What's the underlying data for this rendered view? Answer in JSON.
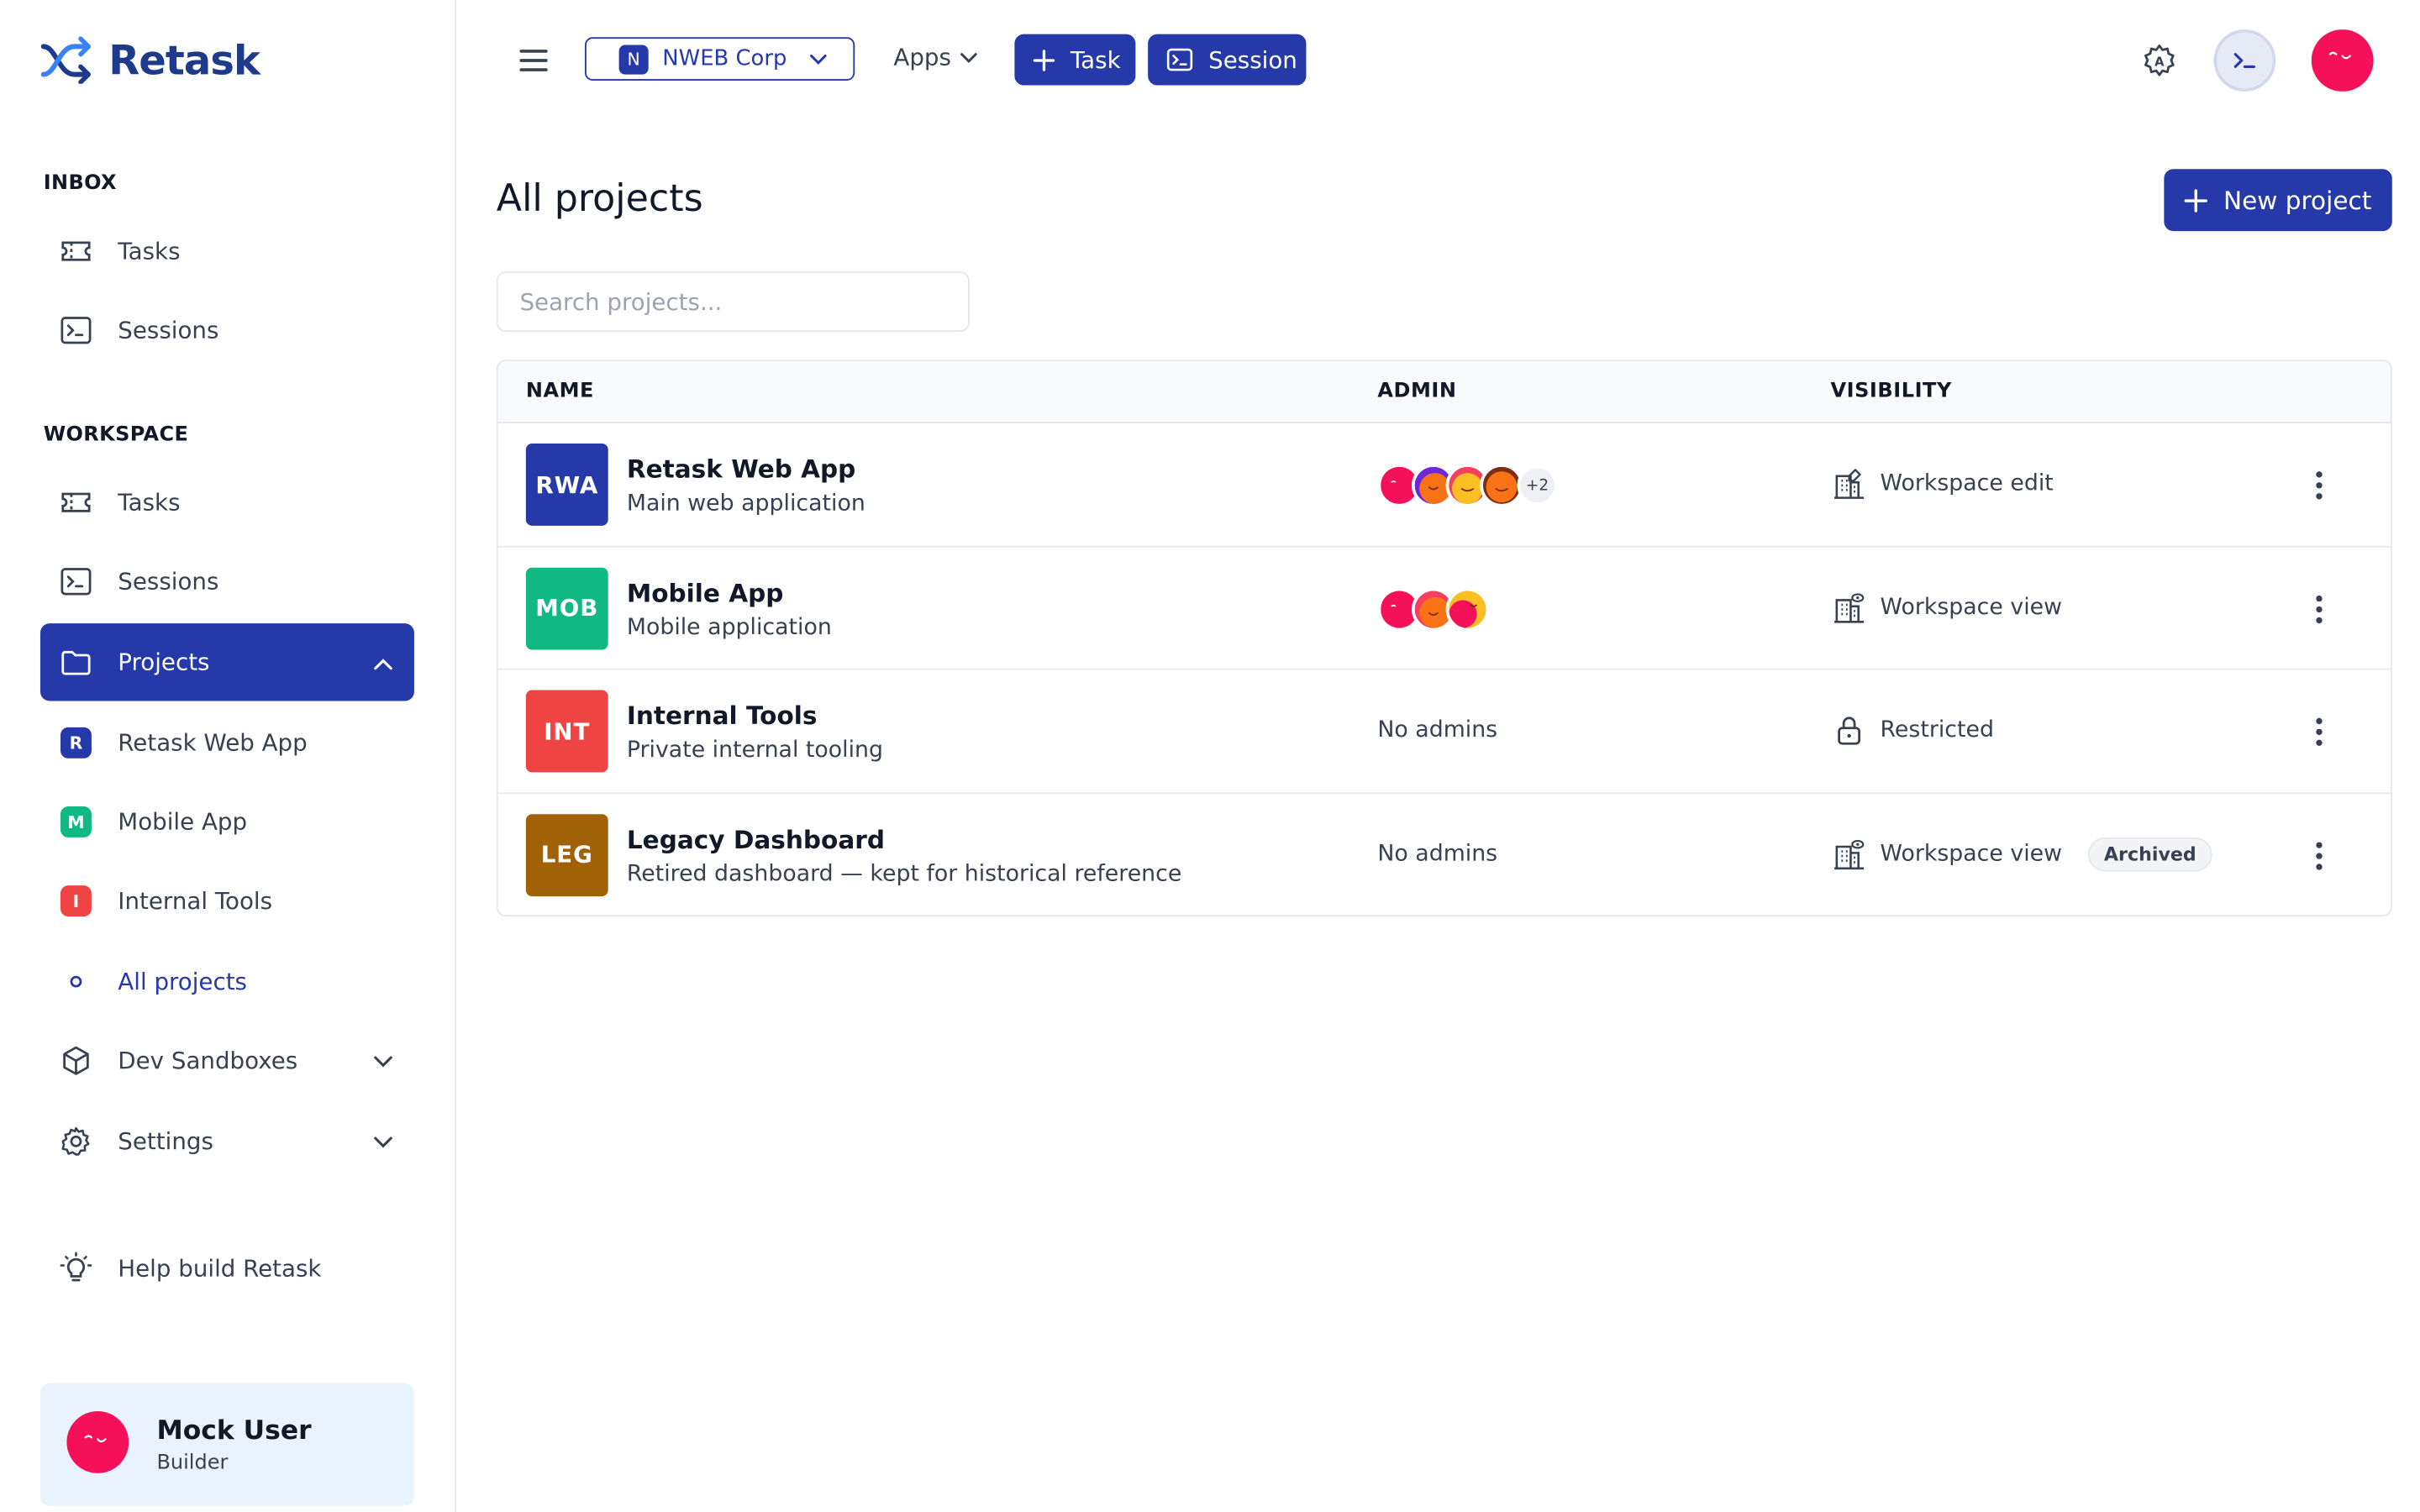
{
  "app": {
    "name": "Retask"
  },
  "colors": {
    "accent": "#2639a8",
    "rwa": "#2639a8",
    "mob": "#10b981",
    "int": "#ef4444",
    "leg": "#a16207"
  },
  "sidebar": {
    "inbox_label": "INBOX",
    "inbox_items": [
      {
        "label": "Tasks",
        "icon": "ticket-icon"
      },
      {
        "label": "Sessions",
        "icon": "terminal-icon"
      }
    ],
    "workspace_label": "WORKSPACE",
    "workspace_items": [
      {
        "label": "Tasks",
        "icon": "ticket-icon"
      },
      {
        "label": "Sessions",
        "icon": "terminal-icon"
      }
    ],
    "projects": {
      "label": "Projects",
      "icon": "folder-icon",
      "expanded": true
    },
    "project_items": [
      {
        "label": "Retask Web App",
        "badge": "R"
      },
      {
        "label": "Mobile App",
        "badge": "M"
      },
      {
        "label": "Internal Tools",
        "badge": "I"
      }
    ],
    "all_projects": "All projects",
    "dev_sandboxes": "Dev Sandboxes",
    "settings": "Settings",
    "help": "Help build Retask",
    "user": {
      "name": "Mock User",
      "role": "Builder"
    }
  },
  "topbar": {
    "org_badge": "N",
    "org_name": "NWEB Corp",
    "apps_label": "Apps",
    "task_label": "Task",
    "session_label": "Session"
  },
  "main": {
    "title": "All projects",
    "new_project_label": "New project",
    "search_placeholder": "Search projects...",
    "columns": {
      "name": "NAME",
      "admin": "ADMIN",
      "visibility": "VISIBILITY"
    },
    "rows": [
      {
        "badge": "RWA",
        "name": "Retask Web App",
        "desc": "Main web application",
        "admins_more": "+2",
        "no_admins": "",
        "visibility": "Workspace edit",
        "vis_icon": "building-edit-icon",
        "archived": ""
      },
      {
        "badge": "MOB",
        "name": "Mobile App",
        "desc": "Mobile application",
        "admins_more": "",
        "no_admins": "",
        "visibility": "Workspace view",
        "vis_icon": "building-view-icon",
        "archived": ""
      },
      {
        "badge": "INT",
        "name": "Internal Tools",
        "desc": "Private internal tooling",
        "admins_more": "",
        "no_admins": "No admins",
        "visibility": "Restricted",
        "vis_icon": "lock-icon",
        "archived": ""
      },
      {
        "badge": "LEG",
        "name": "Legacy Dashboard",
        "desc": "Retired dashboard — kept for historical reference",
        "admins_more": "",
        "no_admins": "No admins",
        "visibility": "Workspace view",
        "vis_icon": "building-view-icon",
        "archived": "Archived"
      }
    ]
  }
}
